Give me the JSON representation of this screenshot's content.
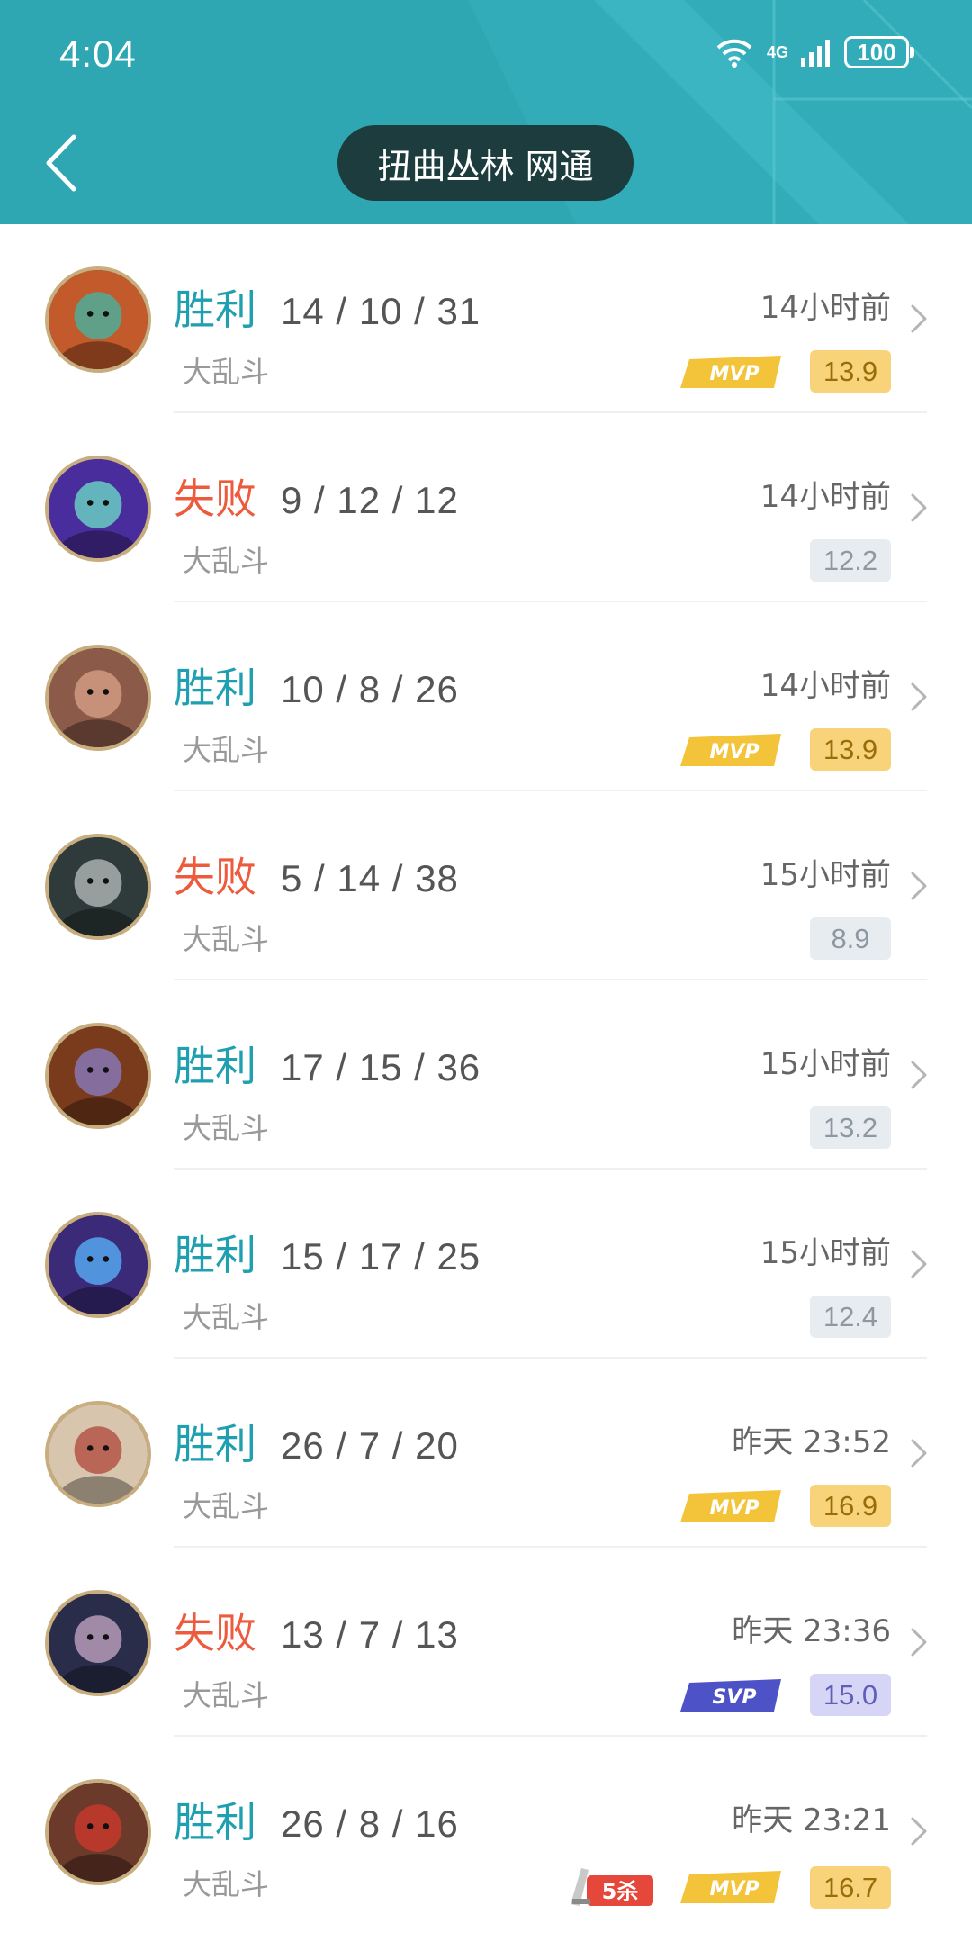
{
  "status_bar": {
    "time": "4:04",
    "network": "4G",
    "battery": "100"
  },
  "header": {
    "title": "扭曲丛林 网通"
  },
  "matches": [
    {
      "result": "胜利",
      "outcome": "win",
      "kda": "14 / 10 / 31",
      "mode": "大乱斗",
      "time": "14小时前",
      "badge": "MVP",
      "score": "13.9",
      "avatar_color": "#c35a2b",
      "avatar_accent": "#3fb7a8"
    },
    {
      "result": "失败",
      "outcome": "loss",
      "kda": "9 / 12 / 12",
      "mode": "大乱斗",
      "time": "14小时前",
      "score": "12.2",
      "avatar_color": "#4a2d9c",
      "avatar_accent": "#6ee1c8"
    },
    {
      "result": "胜利",
      "outcome": "win",
      "kda": "10 / 8 / 26",
      "mode": "大乱斗",
      "time": "14小时前",
      "badge": "MVP",
      "score": "13.9",
      "avatar_color": "#8b5a48",
      "avatar_accent": "#d9a38a"
    },
    {
      "result": "失败",
      "outcome": "loss",
      "kda": "5 / 14 / 38",
      "mode": "大乱斗",
      "time": "15小时前",
      "score": "8.9",
      "avatar_color": "#2f3a3a",
      "avatar_accent": "#b9c2c0"
    },
    {
      "result": "胜利",
      "outcome": "win",
      "kda": "17 / 15 / 36",
      "mode": "大乱斗",
      "time": "15小时前",
      "score": "13.2",
      "avatar_color": "#7a3b1c",
      "avatar_accent": "#8a80c8"
    },
    {
      "result": "胜利",
      "outcome": "win",
      "kda": "15 / 17 / 25",
      "mode": "大乱斗",
      "time": "15小时前",
      "score": "12.4",
      "avatar_color": "#3b2a78",
      "avatar_accent": "#59b8ff"
    },
    {
      "result": "胜利",
      "outcome": "win",
      "kda": "26 / 7 / 20",
      "mode": "大乱斗",
      "time": "昨天 23:52",
      "badge": "MVP",
      "score": "16.9",
      "avatar_color": "#d8c5ae",
      "avatar_accent": "#b0453a"
    },
    {
      "result": "失败",
      "outcome": "loss",
      "kda": "13 / 7 / 13",
      "mode": "大乱斗",
      "time": "昨天 23:36",
      "badge": "SVP",
      "score": "15.0",
      "avatar_color": "#2a2d4a",
      "avatar_accent": "#c9a8c8"
    },
    {
      "result": "胜利",
      "outcome": "win",
      "kda": "26 / 8 / 16",
      "mode": "大乱斗",
      "time": "昨天 23:21",
      "kill_badge": "5杀",
      "badge": "MVP",
      "score": "16.7",
      "avatar_color": "#6b3a2a",
      "avatar_accent": "#d13a2e"
    }
  ],
  "colors": {
    "header": "#2fa7b3",
    "win": "#1f9fb0",
    "loss": "#ee5a3c",
    "mvp": "#f3c43a",
    "svp": "#4d52c7"
  }
}
